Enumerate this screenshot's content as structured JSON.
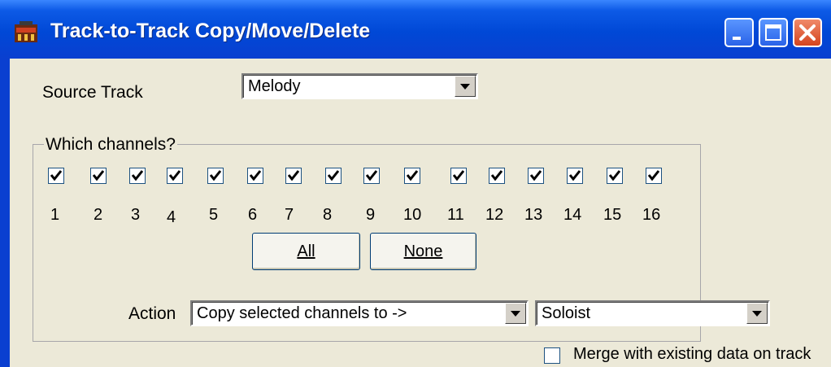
{
  "window": {
    "title": "Track-to-Track Copy/Move/Delete"
  },
  "source": {
    "label": "Source Track",
    "value": "Melody"
  },
  "channels": {
    "group_label": "Which channels?",
    "items": [
      {
        "num": "1",
        "checked": true
      },
      {
        "num": "2",
        "checked": true
      },
      {
        "num": "3",
        "checked": true
      },
      {
        "num": "4",
        "checked": true
      },
      {
        "num": "5",
        "checked": true
      },
      {
        "num": "6",
        "checked": true
      },
      {
        "num": "7",
        "checked": true
      },
      {
        "num": "8",
        "checked": true
      },
      {
        "num": "9",
        "checked": true
      },
      {
        "num": "10",
        "checked": true
      },
      {
        "num": "11",
        "checked": true
      },
      {
        "num": "12",
        "checked": true
      },
      {
        "num": "13",
        "checked": true
      },
      {
        "num": "14",
        "checked": true
      },
      {
        "num": "15",
        "checked": true
      },
      {
        "num": "16",
        "checked": true
      }
    ],
    "all_button": "All",
    "none_button": "None"
  },
  "action": {
    "label": "Action",
    "value": "Copy selected channels to ->",
    "target_value": "Soloist"
  },
  "merge": {
    "label": "Merge with existing data on track",
    "checked": false
  },
  "colors": {
    "titlebar": "#0a3fd0",
    "client": "#ece9d8",
    "close_button": "#d4441e"
  }
}
